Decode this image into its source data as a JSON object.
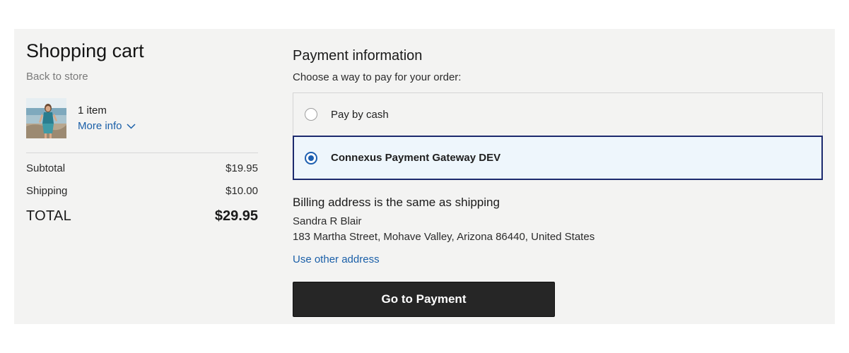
{
  "cart": {
    "title": "Shopping cart",
    "back_link": "Back to store",
    "item_count": "1 item",
    "more_info": "More info",
    "subtotal_label": "Subtotal",
    "subtotal_value": "$19.95",
    "shipping_label": "Shipping",
    "shipping_value": "$10.00",
    "total_label": "TOTAL",
    "total_value": "$29.95"
  },
  "payment": {
    "title": "Payment information",
    "subtitle": "Choose a way to pay for your order:",
    "options": [
      {
        "label": "Pay by cash",
        "selected": false
      },
      {
        "label": "Connexus Payment Gateway DEV",
        "selected": true
      }
    ]
  },
  "billing": {
    "title": "Billing address is the same as shipping",
    "name": "Sandra R Blair",
    "address": "183 Martha Street, Mohave Valley, Arizona 86440, United States",
    "other_address_link": "Use other address"
  },
  "actions": {
    "go_to_payment": "Go to Payment"
  },
  "colors": {
    "panel_bg": "#f3f3f2",
    "link": "#1a5fa8",
    "selected_border": "#1c2a6e",
    "selected_bg": "#eef6fc",
    "button_bg": "#262626"
  }
}
